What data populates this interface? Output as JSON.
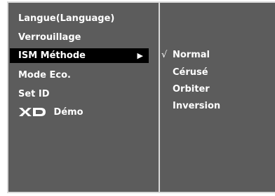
{
  "left_menu": {
    "items": [
      {
        "label": "Langue(Language)"
      },
      {
        "label": "Verrouillage"
      },
      {
        "label": "ISM Méthode",
        "selected": true,
        "arrow": "▶"
      },
      {
        "label": "Mode Eco."
      },
      {
        "label": "Set ID"
      },
      {
        "label": "Démo",
        "icon": "xd-logo-icon"
      }
    ]
  },
  "right_menu": {
    "check_mark": "√",
    "items": [
      {
        "label": "Normal",
        "checked": true
      },
      {
        "label": "Cérusé"
      },
      {
        "label": "Orbiter"
      },
      {
        "label": "Inversion"
      }
    ]
  },
  "colors": {
    "panel_bg": "#5c5c5c",
    "panel_border": "#d9d9d9",
    "selected_bg": "#000000",
    "text": "#ffffff"
  }
}
